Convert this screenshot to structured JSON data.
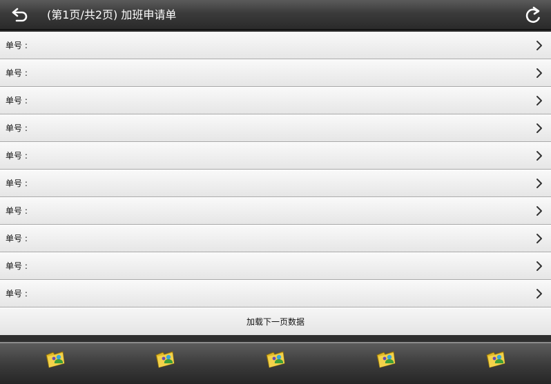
{
  "header": {
    "title": "(第1页/共2页) 加班申请单"
  },
  "list": {
    "rows": [
      {
        "label": "单号 :"
      },
      {
        "label": "单号 :"
      },
      {
        "label": "单号 :"
      },
      {
        "label": "单号 :"
      },
      {
        "label": "单号 :"
      },
      {
        "label": "单号 :"
      },
      {
        "label": "单号 :"
      },
      {
        "label": "单号 :"
      },
      {
        "label": "单号 :"
      },
      {
        "label": "单号 :"
      }
    ],
    "load_more_label": "加载下一页数据"
  },
  "icons": {
    "back": "back-arrow-icon",
    "refresh": "refresh-icon",
    "row_chevron": "chevron-right-icon",
    "toolbar": "folder-user-icon"
  },
  "colors": {
    "header_bg": "#3b3b3b",
    "row_bg": "#ececec",
    "toolbar_bg": "#3a3a3a"
  }
}
